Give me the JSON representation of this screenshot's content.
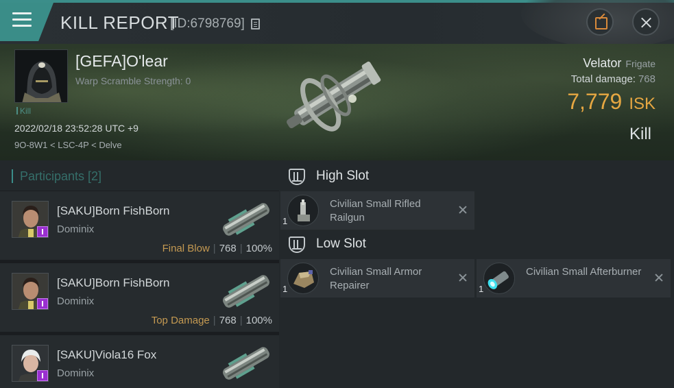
{
  "header": {
    "title": "KILL REPORT",
    "kill_id": "[ID:6798769]"
  },
  "victim": {
    "name": "[GEFA]O'lear",
    "warp_scramble": "Warp Scramble Strength: 0",
    "kill_tag": "Kill",
    "timestamp": "2022/02/18 23:52:28 UTC +9",
    "location": "9O-8W1 < LSC-4P < Delve"
  },
  "ship": {
    "name": "Velator",
    "class": "Frigate",
    "total_damage_label": "Total damage:",
    "total_damage_value": "768",
    "isk_value": "7,779",
    "isk_unit": "ISK",
    "result": "Kill"
  },
  "participants": {
    "title": "Participants [2]",
    "items": [
      {
        "name": "[SAKU]Born FishBorn",
        "ship": "Dominix",
        "role": "Final Blow",
        "damage": "768",
        "percent": "100%"
      },
      {
        "name": "[SAKU]Born FishBorn",
        "ship": "Dominix",
        "role": "Top Damage",
        "damage": "768",
        "percent": "100%"
      },
      {
        "name": "[SAKU]Viola16 Fox",
        "ship": "Dominix",
        "role": "",
        "damage": "",
        "percent": ""
      }
    ]
  },
  "slots": {
    "high": {
      "label": "High Slot",
      "modules": [
        {
          "name": "Civilian Small Rifled Railgun",
          "qty": "1",
          "icon": "railgun-icon"
        }
      ]
    },
    "low": {
      "label": "Low Slot",
      "modules": [
        {
          "name": "Civilian Small Armor Repairer",
          "qty": "1",
          "icon": "armor-repairer-icon"
        },
        {
          "name": "Civilian Small Afterburner",
          "qty": "1",
          "icon": "afterburner-icon"
        }
      ]
    }
  },
  "colors": {
    "accent": "#3b8e8a",
    "isk": "#e6a742",
    "role": "#c59a52",
    "badge": "#9a2fd0"
  }
}
